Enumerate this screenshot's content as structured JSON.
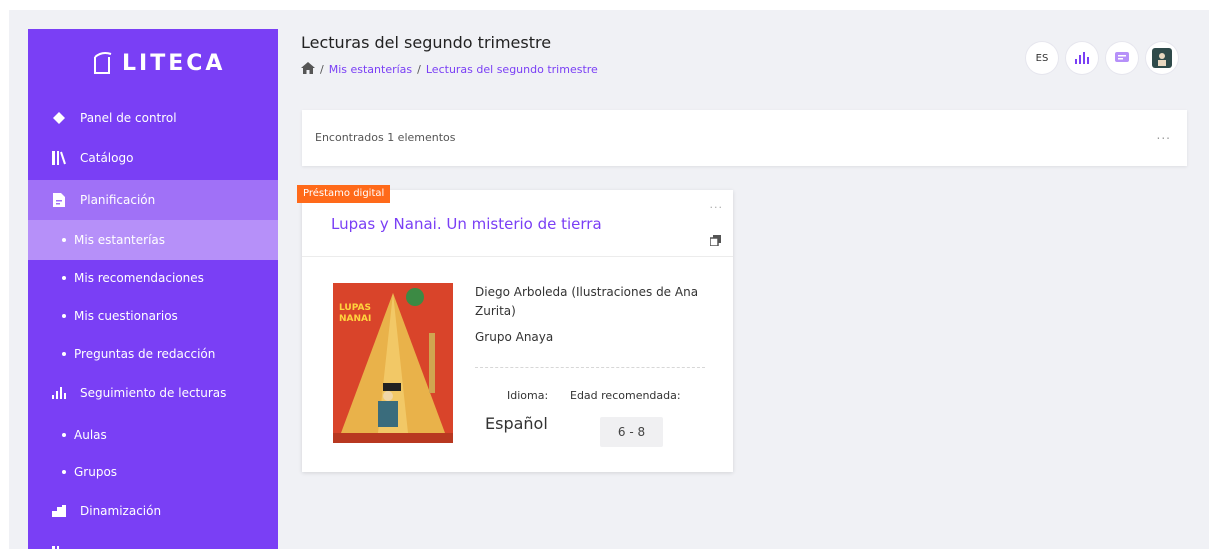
{
  "app": {
    "logo_text": "LITECA"
  },
  "sidebar": {
    "items": [
      {
        "label": "Panel de control"
      },
      {
        "label": "Catálogo"
      },
      {
        "label": "Planificación"
      },
      {
        "label": "Mis estanterías"
      },
      {
        "label": "Mis recomendaciones"
      },
      {
        "label": "Mis cuestionarios"
      },
      {
        "label": "Preguntas de redacción"
      },
      {
        "label": "Seguimiento de lecturas"
      },
      {
        "label": "Aulas"
      },
      {
        "label": "Grupos"
      },
      {
        "label": "Dinamización"
      }
    ]
  },
  "header": {
    "title": "Lecturas del segundo trimestre",
    "breadcrumb": [
      "Mis estanterías",
      "Lecturas del segundo trimestre"
    ],
    "language": "ES"
  },
  "results": {
    "text": "Encontrados 1 elementos",
    "menu": "..."
  },
  "card": {
    "badge": "Préstamo digital",
    "title": "Lupas y Nanai. Un misterio de tierra",
    "menu": "...",
    "author": "Diego Arboleda (Ilustraciones de Ana Zurita)",
    "publisher": "Grupo Anaya",
    "language_label": "Idioma:",
    "language_value": "Español",
    "age_label": "Edad recomendada:",
    "age_value": "6 - 8"
  },
  "colors": {
    "accent": "#7a3ff5",
    "badge": "#ff6a1a"
  }
}
